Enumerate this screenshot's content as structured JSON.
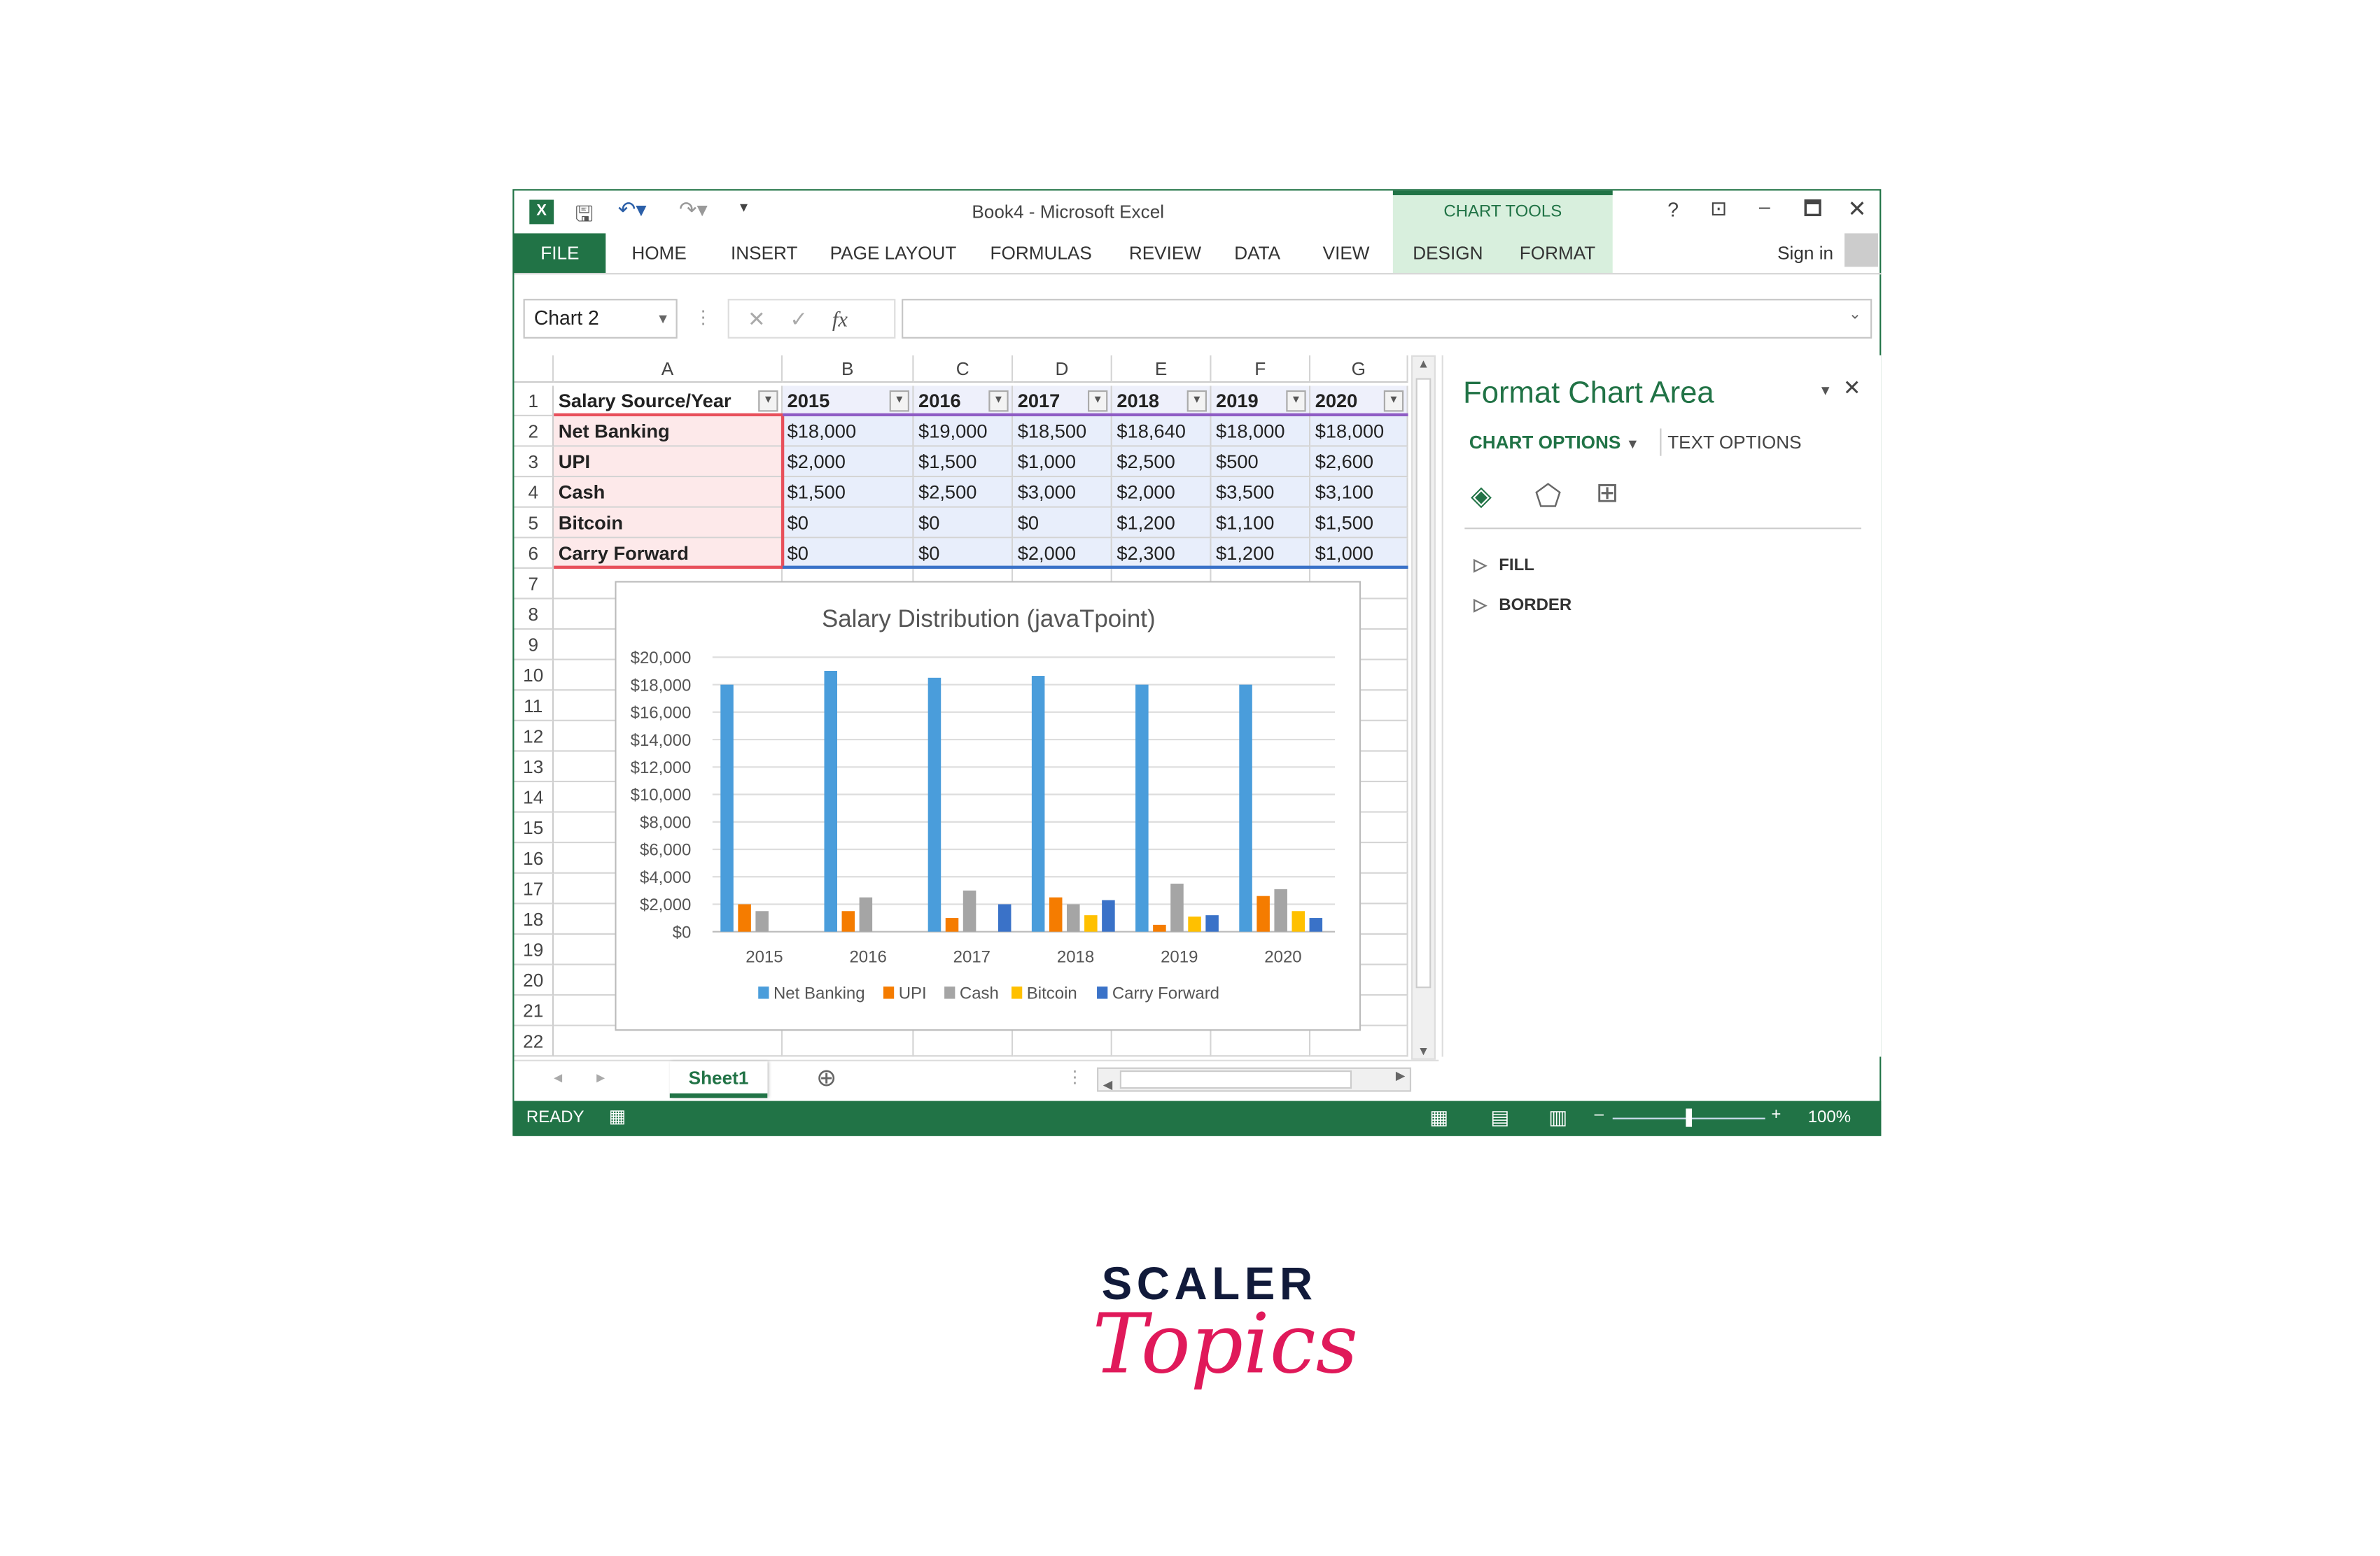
{
  "window": {
    "title": "Book4 - Microsoft Excel",
    "contextual_group": "CHART TOOLS",
    "sign_in": "Sign in"
  },
  "ribbon": {
    "tabs": [
      "FILE",
      "HOME",
      "INSERT",
      "PAGE LAYOUT",
      "FORMULAS",
      "REVIEW",
      "DATA",
      "VIEW"
    ],
    "context_tabs": [
      "DESIGN",
      "FORMAT"
    ]
  },
  "formula_bar": {
    "name_box": "Chart 2",
    "fx": "fx",
    "value": ""
  },
  "sheet": {
    "columns": [
      "A",
      "B",
      "C",
      "D",
      "E",
      "F",
      "G"
    ],
    "rows": [
      [
        "Salary Source/Year",
        "2015",
        "2016",
        "2017",
        "2018",
        "2019",
        "2020"
      ],
      [
        "Net Banking",
        "$18,000",
        "$19,000",
        "$18,500",
        "$18,640",
        "$18,000",
        "$18,000"
      ],
      [
        "UPI",
        "$2,000",
        "$1,500",
        "$1,000",
        "$2,500",
        "$500",
        "$2,600"
      ],
      [
        "Cash",
        "$1,500",
        "$2,500",
        "$3,000",
        "$2,000",
        "$3,500",
        "$3,100"
      ],
      [
        "Bitcoin",
        "$0",
        "$0",
        "$0",
        "$1,200",
        "$1,100",
        "$1,500"
      ],
      [
        "Carry Forward",
        "$0",
        "$0",
        "$2,000",
        "$2,300",
        "$1,200",
        "$1,000"
      ]
    ],
    "row_numbers": [
      "1",
      "2",
      "3",
      "4",
      "5",
      "6",
      "7",
      "8",
      "9",
      "10",
      "11",
      "12",
      "13",
      "14",
      "15",
      "16",
      "17",
      "18",
      "19",
      "20",
      "21",
      "22"
    ],
    "active_sheet": "Sheet1"
  },
  "chart_data": {
    "type": "bar",
    "title": "Salary Distribution (javaTpoint)",
    "categories": [
      "2015",
      "2016",
      "2017",
      "2018",
      "2019",
      "2020"
    ],
    "ylim": [
      0,
      20000
    ],
    "yticks": [
      "$0",
      "$2,000",
      "$4,000",
      "$6,000",
      "$8,000",
      "$10,000",
      "$12,000",
      "$14,000",
      "$16,000",
      "$18,000",
      "$20,000"
    ],
    "grid": true,
    "legend": "bottom",
    "series": [
      {
        "name": "Net Banking",
        "color": "#4a9ddb",
        "values": [
          18000,
          19000,
          18500,
          18640,
          18000,
          18000
        ]
      },
      {
        "name": "UPI",
        "color": "#f57c00",
        "values": [
          2000,
          1500,
          1000,
          2500,
          500,
          2600
        ]
      },
      {
        "name": "Cash",
        "color": "#a5a5a5",
        "values": [
          1500,
          2500,
          3000,
          2000,
          3500,
          3100
        ]
      },
      {
        "name": "Bitcoin",
        "color": "#ffc000",
        "values": [
          0,
          0,
          0,
          1200,
          1100,
          1500
        ]
      },
      {
        "name": "Carry Forward",
        "color": "#3a72c8",
        "values": [
          0,
          0,
          2000,
          2300,
          1200,
          1000
        ]
      }
    ]
  },
  "format_pane": {
    "title": "Format Chart Area",
    "tab_chart": "CHART OPTIONS",
    "tab_text": "TEXT OPTIONS",
    "sections": [
      "FILL",
      "BORDER"
    ]
  },
  "status": {
    "mode": "READY",
    "zoom": "100%"
  },
  "brand": {
    "line1": "SCALER",
    "line2": "Topics"
  },
  "colors": {
    "excel_green": "#217346",
    "accent_pink": "#e0195a"
  }
}
